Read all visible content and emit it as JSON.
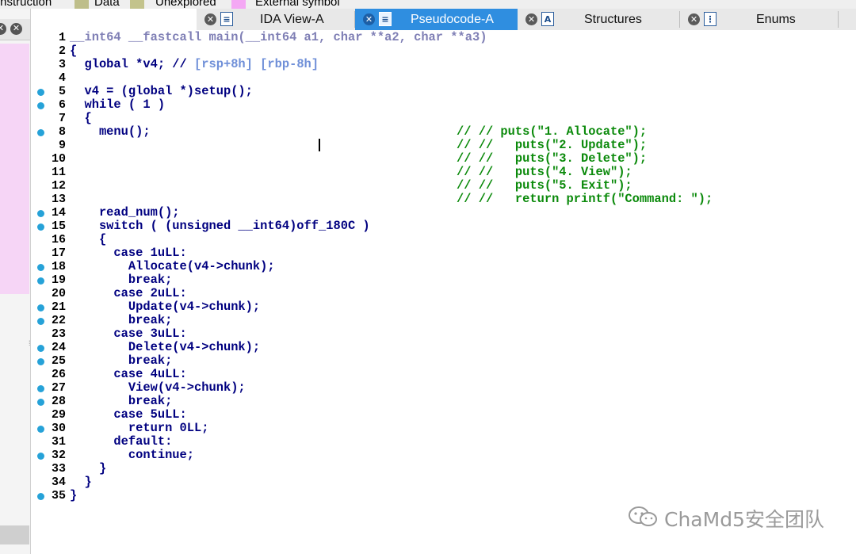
{
  "legend": {
    "items": [
      {
        "label": "Instruction",
        "color": "#f0f0f0"
      },
      {
        "label": "Data",
        "color": "#bebe8a"
      },
      {
        "label": "Unexplored",
        "color": "#c3c38c"
      },
      {
        "label": "External symbol",
        "color": "#f4a8f4"
      }
    ]
  },
  "tabs": [
    {
      "label": "IDA View-A",
      "icon": "list-view-icon",
      "active": false
    },
    {
      "label": "Pseudocode-A",
      "icon": "pseudocode-icon",
      "active": true
    },
    {
      "label": "Structures",
      "icon": "structure-icon",
      "active": false
    },
    {
      "label": "Enums",
      "icon": "enum-icon",
      "active": false
    }
  ],
  "code_lines": [
    {
      "n": "1",
      "bp": false,
      "text": "__int64 __fastcall main(__int64 a1, char **a2, char **a3)",
      "style": "muted",
      "comment": ""
    },
    {
      "n": "2",
      "bp": false,
      "text": "{",
      "style": "",
      "comment": ""
    },
    {
      "n": "3",
      "bp": false,
      "text": "  global *v4; // ",
      "style": "",
      "extra": "[rsp+8h] [rbp-8h]",
      "comment": ""
    },
    {
      "n": "4",
      "bp": false,
      "text": "",
      "style": "",
      "comment": ""
    },
    {
      "n": "5",
      "bp": true,
      "text": "  v4 = (global *)setup();",
      "style": "",
      "comment": ""
    },
    {
      "n": "6",
      "bp": true,
      "text": "  while ( 1 )",
      "style": "",
      "comment": ""
    },
    {
      "n": "7",
      "bp": false,
      "text": "  {",
      "style": "",
      "comment": ""
    },
    {
      "n": "8",
      "bp": true,
      "text": "    menu();",
      "style": "",
      "comment": "// // puts(\"1. Allocate\");"
    },
    {
      "n": "9",
      "bp": false,
      "text": "",
      "style": "",
      "comment": "// //   puts(\"2. Update\");"
    },
    {
      "n": "10",
      "bp": false,
      "text": "",
      "style": "",
      "comment": "// //   puts(\"3. Delete\");"
    },
    {
      "n": "11",
      "bp": false,
      "text": "",
      "style": "",
      "comment": "// //   puts(\"4. View\");"
    },
    {
      "n": "12",
      "bp": false,
      "text": "",
      "style": "",
      "comment": "// //   puts(\"5. Exit\");"
    },
    {
      "n": "13",
      "bp": false,
      "text": "",
      "style": "",
      "comment": "// //   return printf(\"Command: \");"
    },
    {
      "n": "14",
      "bp": true,
      "text": "    read_num();",
      "style": "",
      "comment": ""
    },
    {
      "n": "15",
      "bp": true,
      "text": "    switch ( (unsigned __int64)off_180C )",
      "style": "",
      "comment": ""
    },
    {
      "n": "16",
      "bp": false,
      "text": "    {",
      "style": "",
      "comment": ""
    },
    {
      "n": "17",
      "bp": false,
      "text": "      case 1uLL:",
      "style": "",
      "comment": ""
    },
    {
      "n": "18",
      "bp": true,
      "text": "        Allocate(v4->chunk);",
      "style": "",
      "comment": ""
    },
    {
      "n": "19",
      "bp": true,
      "text": "        break;",
      "style": "",
      "comment": ""
    },
    {
      "n": "20",
      "bp": false,
      "text": "      case 2uLL:",
      "style": "",
      "comment": ""
    },
    {
      "n": "21",
      "bp": true,
      "text": "        Update(v4->chunk);",
      "style": "",
      "comment": ""
    },
    {
      "n": "22",
      "bp": true,
      "text": "        break;",
      "style": "",
      "comment": ""
    },
    {
      "n": "23",
      "bp": false,
      "text": "      case 3uLL:",
      "style": "",
      "comment": ""
    },
    {
      "n": "24",
      "bp": true,
      "text": "        Delete(v4->chunk);",
      "style": "",
      "comment": ""
    },
    {
      "n": "25",
      "bp": true,
      "text": "        break;",
      "style": "",
      "comment": ""
    },
    {
      "n": "26",
      "bp": false,
      "text": "      case 4uLL:",
      "style": "",
      "comment": ""
    },
    {
      "n": "27",
      "bp": true,
      "text": "        View(v4->chunk);",
      "style": "",
      "comment": ""
    },
    {
      "n": "28",
      "bp": true,
      "text": "        break;",
      "style": "",
      "comment": ""
    },
    {
      "n": "29",
      "bp": false,
      "text": "      case 5uLL:",
      "style": "",
      "comment": ""
    },
    {
      "n": "30",
      "bp": true,
      "text": "        return 0LL;",
      "style": "",
      "comment": ""
    },
    {
      "n": "31",
      "bp": false,
      "text": "      default:",
      "style": "",
      "comment": ""
    },
    {
      "n": "32",
      "bp": true,
      "text": "        continue;",
      "style": "",
      "comment": ""
    },
    {
      "n": "33",
      "bp": false,
      "text": "    }",
      "style": "",
      "comment": ""
    },
    {
      "n": "34",
      "bp": false,
      "text": "  }",
      "style": "",
      "comment": ""
    },
    {
      "n": "35",
      "bp": true,
      "text": "}",
      "style": "",
      "comment": ""
    }
  ],
  "watermark": {
    "text": "ChaMd5安全团队",
    "icon": "wechat-icon"
  },
  "colors": {
    "code": "#000080",
    "comment": "#0b8a0b",
    "breakpoint": "#26a2d8",
    "active_tab": "#2f8ee0"
  }
}
